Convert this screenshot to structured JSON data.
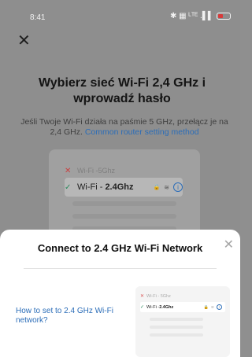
{
  "status_bar": {
    "time": "8:41",
    "icons": [
      "bluetooth-icon",
      "data-icon",
      "signal-icon",
      "battery-icon"
    ],
    "indicators": "✱ ▦ ᴸᵀᴱ .▌▌"
  },
  "page": {
    "close_icon": "✕",
    "heading": "Wybierz sieć Wi-Fi 2,4 GHz i wprowadź hasło",
    "description": "Jeśli Twoje Wi-Fi działa na paśmie 5 GHz, przełącz je na 2,4 GHz.",
    "description_link": "Common router setting method"
  },
  "preview": {
    "row_5ghz_prefix": "Wi-Fi - ",
    "row_5ghz_band": "5Ghz",
    "row_24_prefix": "Wi-Fi - ",
    "row_24_band": "2.4Ghz",
    "lock_icon": "▲",
    "wifi_icon": "▴",
    "info_icon": "i"
  },
  "sheet": {
    "title": "Connect to 2.4 GHz Wi-Fi Network",
    "close_icon": "✕",
    "how_to_link": "How to set to 2.4 GHz Wi-Fi network?",
    "mini_5ghz": "Wi-Fi - 5Ghz",
    "mini_24_prefix": "Wi-Fi - ",
    "mini_24_band": "2.4Ghz",
    "mini_info_icon": "i"
  },
  "colors": {
    "accent_link": "#2b6db8",
    "check_green": "#2b8a5d",
    "cross_red": "#c94040",
    "overlay": "#8e8e8e"
  }
}
